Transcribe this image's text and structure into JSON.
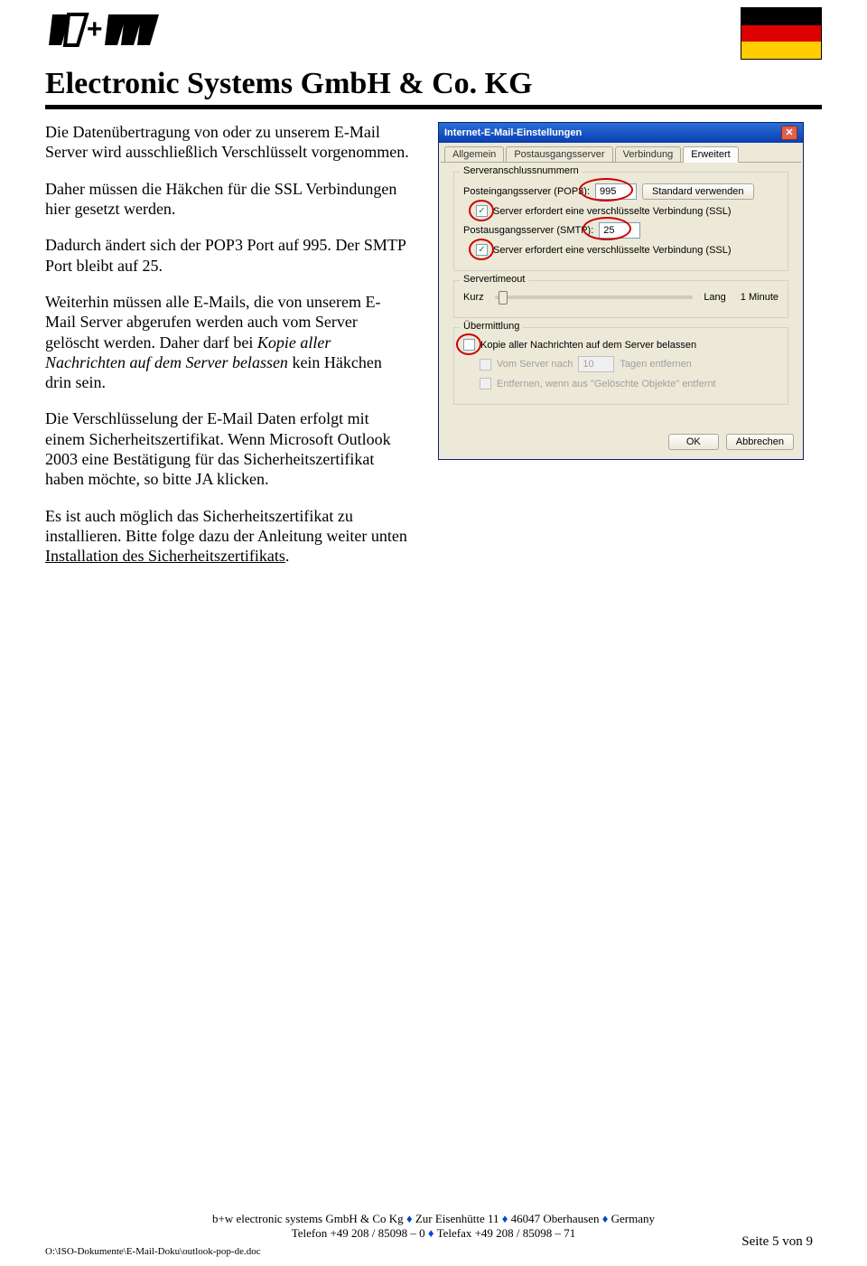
{
  "header": {
    "company": "Electronic Systems GmbH & Co. KG"
  },
  "body": {
    "p1": "Die Datenübertragung von oder zu unserem E-Mail Server wird ausschließlich Verschlüsselt vorgenommen.",
    "p2": "Daher müssen die Häkchen für die SSL Verbindungen hier gesetzt werden.",
    "p3": "Dadurch ändert sich der POP3 Port auf 995. Der SMTP Port bleibt auf 25.",
    "p4a": "Weiterhin müssen alle E-Mails, die von unserem E-Mail Server abgerufen werden auch vom Server gelöscht werden. Daher darf bei ",
    "p4i": "Kopie aller Nachrichten auf dem Server belassen",
    "p4b": " kein Häkchen drin sein.",
    "p5": "Die Verschlüsselung der E-Mail Daten erfolgt mit einem Sicherheitszertifikat. Wenn Microsoft Outlook 2003 eine Bestätigung für das Sicherheitszertifikat haben möchte, so bitte JA klicken.",
    "p6a": "Es ist auch möglich das Sicherheitszertifikat zu installieren. Bitte folge dazu der Anleitung weiter unten ",
    "p6u": "Installation des Sicherheitszertifikats",
    "p6b": "."
  },
  "dialog": {
    "title": "Internet-E-Mail-Einstellungen",
    "tabs": [
      "Allgemein",
      "Postausgangsserver",
      "Verbindung",
      "Erweitert"
    ],
    "active_tab": 3,
    "group1": {
      "title": "Serveranschlussnummern",
      "pop3_label": "Posteingangsserver (POP3):",
      "pop3_value": "995",
      "std_btn": "Standard verwenden",
      "ssl1_label": "Server erfordert eine verschlüsselte Verbindung (SSL)",
      "smtp_label": "Postausgangsserver (SMTP):",
      "smtp_value": "25",
      "ssl2_label": "Server erfordert eine verschlüsselte Verbindung (SSL)"
    },
    "group2": {
      "title": "Servertimeout",
      "short": "Kurz",
      "long": "Lang",
      "minute": "1 Minute"
    },
    "group3": {
      "title": "Übermittlung",
      "keep_label": "Kopie aller Nachrichten auf dem Server belassen",
      "remove_after_label_a": "Vom Server nach",
      "remove_after_days": "10",
      "remove_after_label_b": "Tagen entfernen",
      "remove_deleted_label": "Entfernen, wenn aus \"Gelöschte Objekte\" entfernt"
    },
    "ok": "OK",
    "cancel": "Abbrechen"
  },
  "footer": {
    "line1a": "b+w electronic systems GmbH & Co Kg ",
    "line1b": " Zur Eisenhütte 11 ",
    "line1c": " 46047 Oberhausen ",
    "line1d": " Germany",
    "line2a": "Telefon +49 208 / 85098 – 0 ",
    "line2b": " Telefax +49 208 / 85098 – 71",
    "pagenum": "Seite 5 von 9",
    "docpath": "O:\\ISO-Dokumente\\E-Mail-Doku\\outlook-pop-de.doc"
  }
}
